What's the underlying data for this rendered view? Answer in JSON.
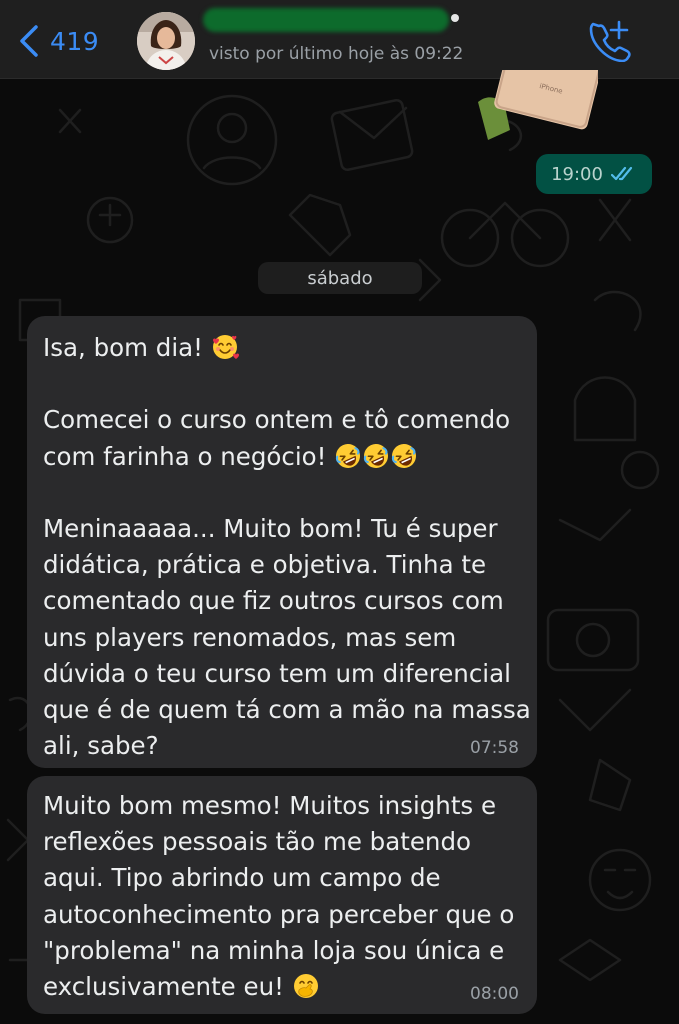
{
  "header": {
    "back_count": "419",
    "last_seen": "visto por último hoje às 09:22",
    "icons": {
      "back": "chevron-left-icon",
      "call": "phone-plus-icon",
      "avatar": "contact-avatar"
    }
  },
  "colors": {
    "accent": "#3b8cf5",
    "outgoing_bubble": "#025144",
    "incoming_bubble": "#2a2a2c",
    "background": "#0b0b0b"
  },
  "messages": [
    {
      "direction": "outgoing",
      "time": "19:00",
      "status": "read"
    },
    {
      "date_divider": "sábado"
    },
    {
      "direction": "incoming",
      "greeting": "Isa, bom dia!",
      "greeting_emoji": "smiling-face-with-hearts-icon",
      "paragraph_1": "Comecei o curso ontem e tô comendo com farinha o negócio!",
      "paragraph_1_emoji": "rolling-on-floor-laughing-icon ×3",
      "paragraph_2": "Meninaaaaa... Muito bom! Tu é super didática, prática e objetiva. Tinha te comentado que fiz outros cursos com uns players renomados, mas sem dúvida o teu curso tem um diferencial que é de quem tá com a mão na massa ali, sabe?",
      "time": "07:58"
    },
    {
      "direction": "incoming",
      "text": "Muito bom mesmo! Muitos insights e reflexões pessoais tão me batendo aqui. Tipo abrindo um campo de autoconhecimento pra perceber que o \"problema\" na minha loja sou única e exclusivamente eu!",
      "emoji": "face-with-hand-over-mouth-icon",
      "time": "08:00"
    }
  ]
}
